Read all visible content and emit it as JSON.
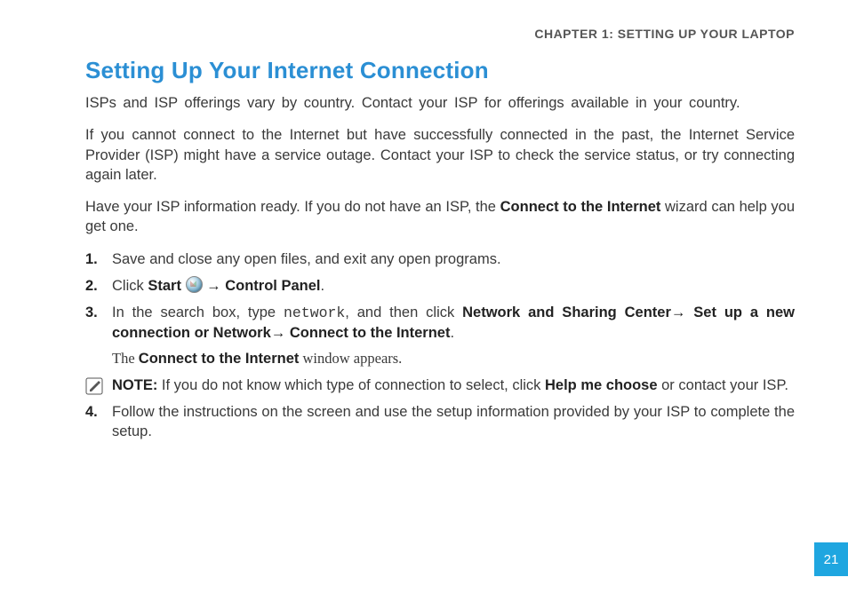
{
  "chapter_header": "CHAPTER 1:  SETTING UP YOUR LAPTOP",
  "section_title": "Setting Up Your Internet Connection",
  "para1": "ISPs and ISP offerings vary by country. Contact your ISP for offerings available in your country.",
  "para2": "If you cannot connect to the Internet but have successfully connected in the past, the Internet Service Provider (ISP) might have a service outage. Contact your ISP to check the service status, or try connecting again later.",
  "para3_a": "Have your ISP information ready. If you do not have an ISP, the ",
  "para3_bold": "Connect to the Internet",
  "para3_b": " wizard can help you get one.",
  "steps": {
    "n1": "1.",
    "s1": "Save and close any open files, and exit any open programs.",
    "n2": "2.",
    "s2_a": "Click ",
    "s2_start": "Start",
    "s2_arrow": " → ",
    "s2_cp": "Control Panel",
    "s2_end": ".",
    "n3": "3.",
    "s3_a": "In the search box, type ",
    "s3_code": "network",
    "s3_b": ", and then click ",
    "s3_nsc": "Network and Sharing Center",
    "s3_arr1": "→ ",
    "s3_setup": "Set up a new connection or Network",
    "s3_arr2": "→ ",
    "s3_conn": "Connect to the Internet",
    "s3_end": ".",
    "s3_sub_a": "The ",
    "s3_sub_bold": "Connect to the Internet",
    "s3_sub_b": " window appears.",
    "n4": "4.",
    "s4": "Follow the instructions on the screen and use the setup information provided by your ISP to complete the setup."
  },
  "note": {
    "label": "NOTE:",
    "text_a": " If you do not know which type of connection to select, click ",
    "help": "Help me choose",
    "text_b": " or contact your ISP."
  },
  "page_number": "21"
}
